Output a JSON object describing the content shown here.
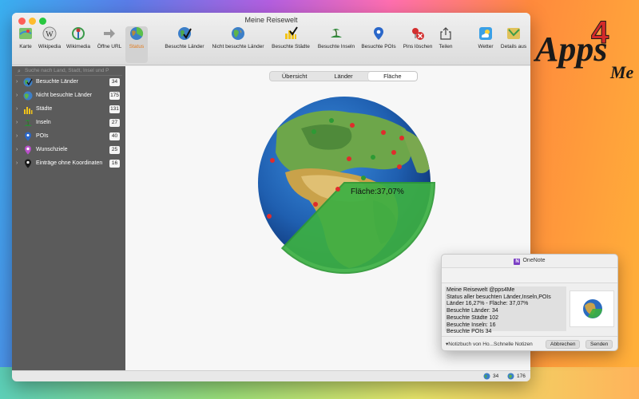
{
  "window": {
    "title": "Meine Reisewelt"
  },
  "toolbar": [
    {
      "label": "Karte",
      "icon": "map-icon"
    },
    {
      "label": "Wikipedia",
      "icon": "wikipedia-icon"
    },
    {
      "label": "Wikimedia",
      "icon": "wikimedia-icon"
    },
    {
      "label": "Öffne URL",
      "icon": "arrow-right-icon"
    },
    {
      "label": "Status",
      "icon": "status-globe-icon",
      "active": true
    },
    {
      "label": "Besuchte Länder",
      "icon": "visited-globe-icon"
    },
    {
      "label": "Nicht besuchte Länder",
      "icon": "globe-icon"
    },
    {
      "label": "Besuchte Städte",
      "icon": "city-icon"
    },
    {
      "label": "Besuchte Inseln",
      "icon": "island-icon"
    },
    {
      "label": "Besuchte POIs",
      "icon": "pin-icon"
    },
    {
      "label": "Pins löschen",
      "icon": "delete-pins-icon"
    },
    {
      "label": "Teilen",
      "icon": "share-icon"
    },
    {
      "label": "Wetter",
      "icon": "weather-icon"
    },
    {
      "label": "Details aus",
      "icon": "details-icon"
    }
  ],
  "sidebar": {
    "search_placeholder": "Suche nach Land, Stadt, Insel und P",
    "items": [
      {
        "label": "Besuchte Länder",
        "count": "34",
        "icon": "visited-globe-icon"
      },
      {
        "label": "Nicht besuchte Länder",
        "count": "175",
        "icon": "globe-icon"
      },
      {
        "label": "Städte",
        "count": "131",
        "icon": "city-icon"
      },
      {
        "label": "Inseln",
        "count": "27",
        "icon": "island-icon"
      },
      {
        "label": "POIs",
        "count": "40",
        "icon": "pin-icon"
      },
      {
        "label": "Wunschziele",
        "count": "25",
        "icon": "wishlist-icon"
      },
      {
        "label": "Einträge ohne Koordinaten",
        "count": "16",
        "icon": "location-pin-icon"
      }
    ]
  },
  "segments": [
    {
      "label": "Übersicht",
      "selected": false
    },
    {
      "label": "Länder",
      "selected": false
    },
    {
      "label": "Fläche",
      "selected": true
    }
  ],
  "globe": {
    "area_label": "Fläche:37,07%",
    "area_fraction": 0.3707,
    "highlight_color": "#3cb043"
  },
  "statusbar": {
    "visited_count": "34",
    "total_count": "176"
  },
  "onenote": {
    "title": "OneNote",
    "lines": [
      "Meine Reisewelt @pps4Me",
      "Status aller besuchten Länder,Inseln,POIs",
      "Länder 16,27% - Fläche: 37,07%",
      "Besuchte Länder: 34",
      "Besuchte Städte 102",
      "Besuchte Inseln: 16",
      "Besuchte POIs 34"
    ],
    "notebook": "▾Notizbuch von Ho...Schnelle Notizen",
    "cancel": "Abbrechen",
    "send": "Senden"
  },
  "brand": {
    "text_main": "Apps",
    "text_num": "4",
    "text_me": "Me"
  }
}
